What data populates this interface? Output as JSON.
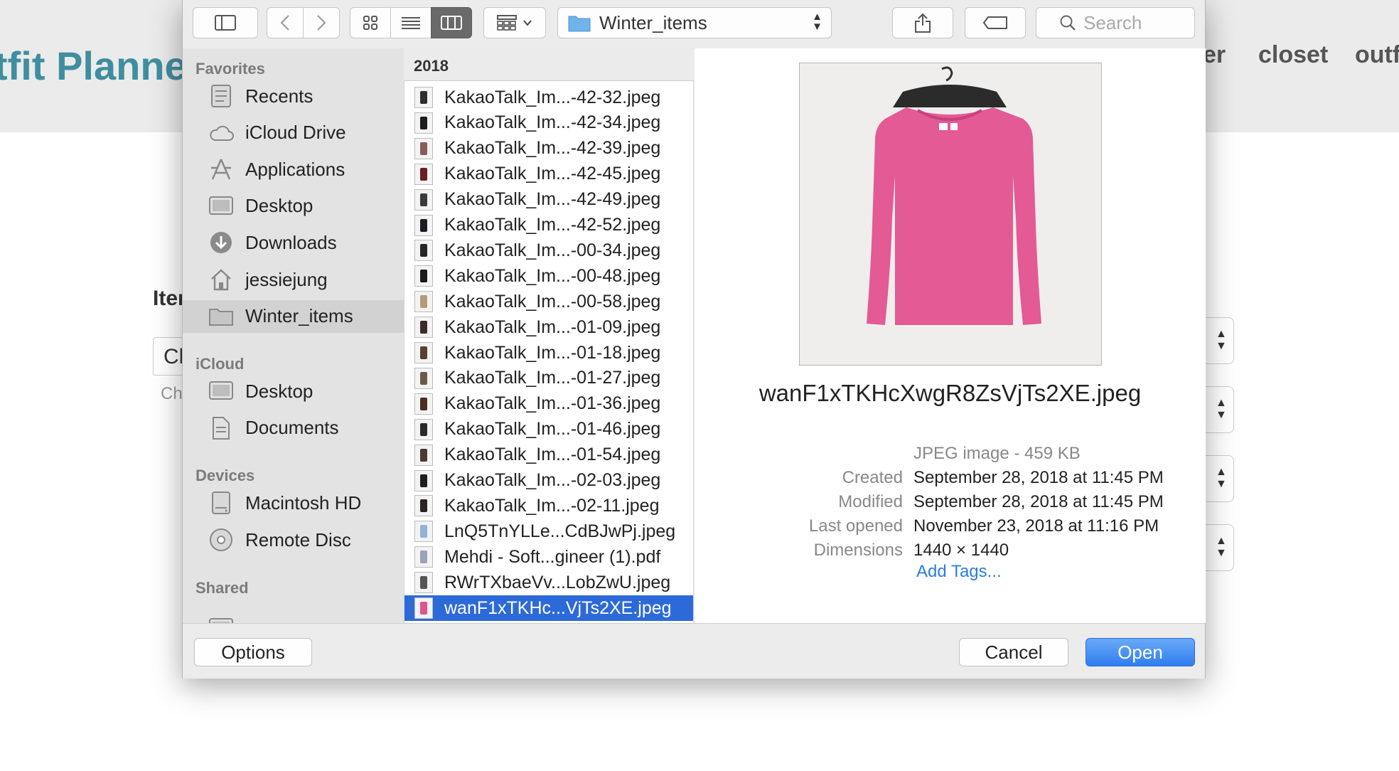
{
  "background_page": {
    "brand": "tfit Planne",
    "nav": [
      "er",
      "closet",
      "outf"
    ],
    "section_label": "Iter",
    "input_value": "Ch",
    "input_hint": "Ch"
  },
  "toolbar": {
    "path": "Winter_items",
    "search_placeholder": "Search"
  },
  "sidebar": {
    "sections": [
      {
        "title": "Favorites",
        "items": [
          {
            "label": "Recents",
            "icon": "recents-icon"
          },
          {
            "label": "iCloud Drive",
            "icon": "cloud-icon"
          },
          {
            "label": "Applications",
            "icon": "applications-icon"
          },
          {
            "label": "Desktop",
            "icon": "desktop-icon"
          },
          {
            "label": "Downloads",
            "icon": "downloads-icon"
          },
          {
            "label": "jessiejung",
            "icon": "home-icon"
          },
          {
            "label": "Winter_items",
            "icon": "folder-icon",
            "selected": true
          }
        ]
      },
      {
        "title": "iCloud",
        "items": [
          {
            "label": "Desktop",
            "icon": "desktop-icon"
          },
          {
            "label": "Documents",
            "icon": "document-icon"
          }
        ]
      },
      {
        "title": "Devices",
        "items": [
          {
            "label": "Macintosh HD",
            "icon": "drive-icon"
          },
          {
            "label": "Remote Disc",
            "icon": "disc-icon"
          }
        ]
      },
      {
        "title": "Shared",
        "items": []
      }
    ]
  },
  "column": {
    "header": "2018",
    "files": [
      {
        "name": "KakaoTalk_Im...-42-32.jpeg",
        "color": "#2e2e2e"
      },
      {
        "name": "KakaoTalk_Im...-42-34.jpeg",
        "color": "#1e1e1e"
      },
      {
        "name": "KakaoTalk_Im...-42-39.jpeg",
        "color": "#8a5a5a"
      },
      {
        "name": "KakaoTalk_Im...-42-45.jpeg",
        "color": "#6b1f24"
      },
      {
        "name": "KakaoTalk_Im...-42-49.jpeg",
        "color": "#3a3a3a"
      },
      {
        "name": "KakaoTalk_Im...-42-52.jpeg",
        "color": "#1c1c22"
      },
      {
        "name": "KakaoTalk_Im...-00-34.jpeg",
        "color": "#262626"
      },
      {
        "name": "KakaoTalk_Im...-00-48.jpeg",
        "color": "#1a1a1a"
      },
      {
        "name": "KakaoTalk_Im...-00-58.jpeg",
        "color": "#b59b7a"
      },
      {
        "name": "KakaoTalk_Im...-01-09.jpeg",
        "color": "#3b2e27"
      },
      {
        "name": "KakaoTalk_Im...-01-18.jpeg",
        "color": "#5a4032"
      },
      {
        "name": "KakaoTalk_Im...-01-27.jpeg",
        "color": "#6b5a4a"
      },
      {
        "name": "KakaoTalk_Im...-01-36.jpeg",
        "color": "#4a2e22"
      },
      {
        "name": "KakaoTalk_Im...-01-46.jpeg",
        "color": "#2a2a2a"
      },
      {
        "name": "KakaoTalk_Im...-01-54.jpeg",
        "color": "#4a3a32"
      },
      {
        "name": "KakaoTalk_Im...-02-03.jpeg",
        "color": "#1e1e1e"
      },
      {
        "name": "KakaoTalk_Im...-02-11.jpeg",
        "color": "#2a2422"
      },
      {
        "name": "LnQ5TnYLLe...CdBJwPj.jpeg",
        "color": "#8fb4d6"
      },
      {
        "name": "Mehdi - Soft...gineer (1).pdf",
        "color": "#9aa3b8"
      },
      {
        "name": "RWrTXbaeVv...LobZwU.jpeg",
        "color": "#555555"
      },
      {
        "name": "wanF1xTKHc...VjTs2XE.jpeg",
        "color": "#e0558f",
        "selected": true
      }
    ]
  },
  "preview": {
    "filename": "wanF1xTKHcXwgR8ZsVjTs2XE.jpeg",
    "kind": "JPEG image - 459 KB",
    "rows": [
      {
        "key": "Created",
        "value": "September 28, 2018 at 11:45 PM"
      },
      {
        "key": "Modified",
        "value": "September 28, 2018 at 11:45 PM"
      },
      {
        "key": "Last opened",
        "value": "November 23, 2018 at 11:16 PM"
      },
      {
        "key": "Dimensions",
        "value": "1440 × 1440"
      }
    ],
    "add_tags": "Add Tags...",
    "sweater_color": "#e35a95"
  },
  "buttons": {
    "options": "Options",
    "cancel": "Cancel",
    "open": "Open"
  }
}
